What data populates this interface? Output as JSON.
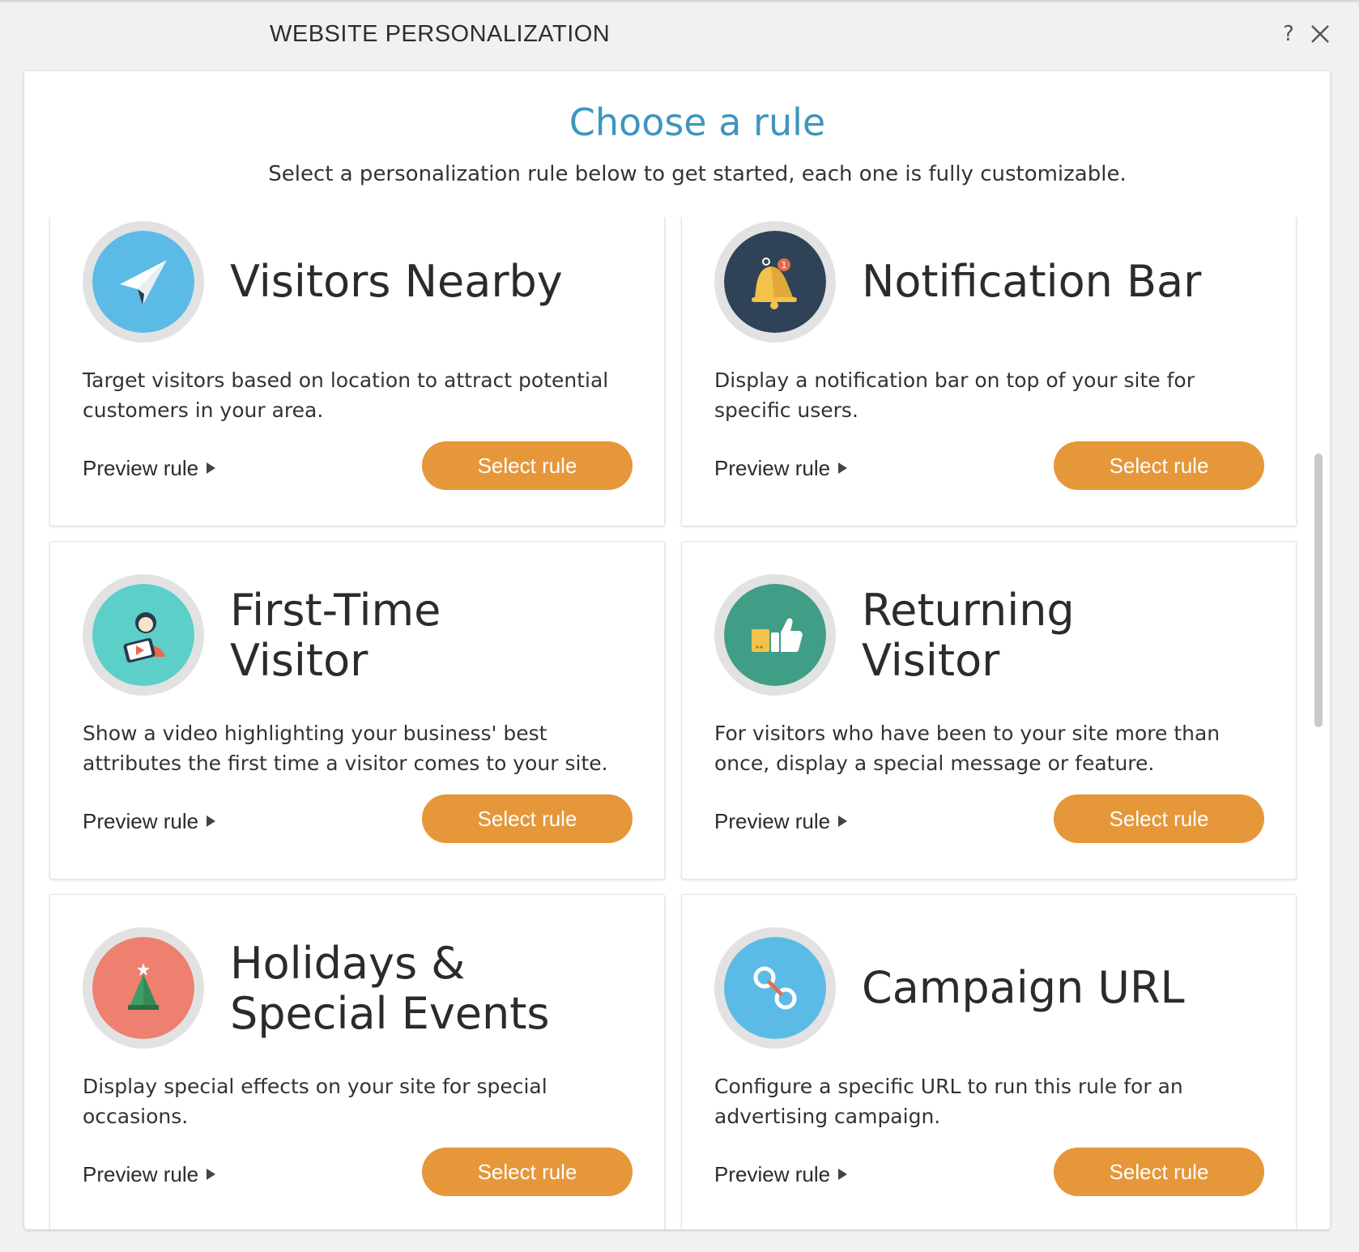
{
  "window": {
    "title": "WEBSITE PERSONALIZATION",
    "help_label": "?"
  },
  "panel": {
    "title": "Choose a rule",
    "subtitle": "Select a personalization rule below to get started, each one is fully customizable."
  },
  "colors": {
    "accent_blue": "#3e95bf",
    "button_orange": "#e5973a"
  },
  "cards": [
    {
      "title_lines": [
        "Visitors Nearby",
        ""
      ],
      "description": "Target visitors based on location to attract potential customers in your area.",
      "preview_label": "Preview rule",
      "select_label": "Select rule",
      "icon": "paper-plane-icon",
      "icon_color": "#5bbbe6"
    },
    {
      "title_lines": [
        "Notification Bar",
        ""
      ],
      "description": "Display a notification bar on top of your site for specific users.",
      "preview_label": "Preview rule",
      "select_label": "Select rule",
      "icon": "bell-icon",
      "icon_color": "#2f4257"
    },
    {
      "title_lines": [
        "First-Time",
        "Visitor"
      ],
      "description": "Show a video highlighting your business' best attributes the first time a visitor comes to your site.",
      "preview_label": "Preview rule",
      "select_label": "Select rule",
      "icon": "video-person-icon",
      "icon_color": "#5ccfc9"
    },
    {
      "title_lines": [
        "Returning",
        "Visitor"
      ],
      "description": "For visitors who have been to your site more than once, display a special message or feature.",
      "preview_label": "Preview rule",
      "select_label": "Select rule",
      "icon": "thumbs-up-icon",
      "icon_color": "#3f9e85"
    },
    {
      "title_lines": [
        "Holidays &",
        "Special Events"
      ],
      "description": "Display special effects on your site for special occasions.",
      "preview_label": "Preview rule",
      "select_label": "Select rule",
      "icon": "christmas-tree-icon",
      "icon_color": "#ee8070"
    },
    {
      "title_lines": [
        "Campaign URL",
        ""
      ],
      "description": "Configure a specific URL to run this rule for an advertising campaign.",
      "preview_label": "Preview rule",
      "select_label": "Select rule",
      "icon": "link-icon",
      "icon_color": "#5bbbe6"
    }
  ]
}
